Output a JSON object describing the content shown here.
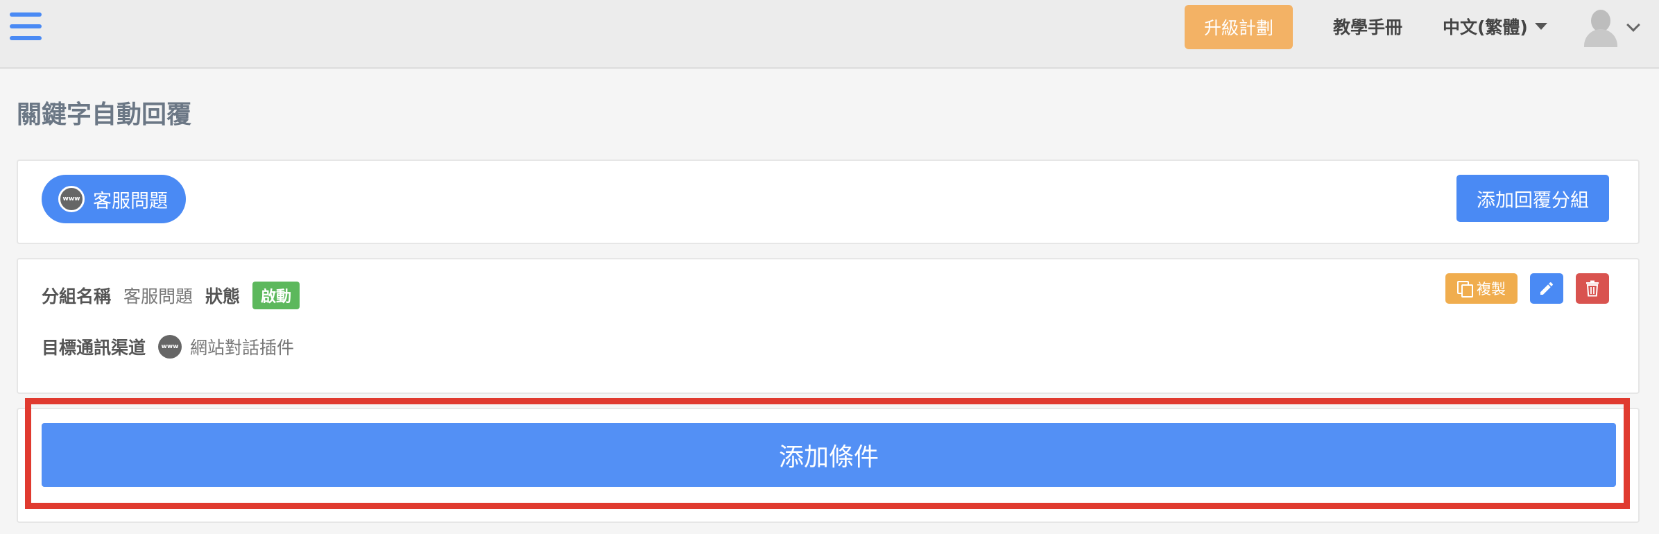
{
  "topbar": {
    "upgrade_label": "升級計劃",
    "manual_label": "教學手冊",
    "language_label": "中文(繁體)"
  },
  "page": {
    "title": "關鍵字自動回覆"
  },
  "groups": {
    "active_group_label": "客服問題",
    "channel_badge": "www",
    "add_group_label": "添加回覆分組"
  },
  "detail": {
    "group_name_label": "分組名稱",
    "group_name_value": "客服問題",
    "status_label": "狀態",
    "status_value": "啟動",
    "channel_label": "目標通訊渠道",
    "channel_badge": "www",
    "channel_value": "網站對話插件",
    "copy_label": "複製"
  },
  "conditions": {
    "add_condition_label": "添加條件"
  },
  "colors": {
    "primary": "#4a8af4",
    "upgrade": "#f3b265",
    "copy": "#f0ad4e",
    "delete": "#d9534f",
    "status_active": "#5cb85c",
    "highlight": "#e03a2f"
  }
}
